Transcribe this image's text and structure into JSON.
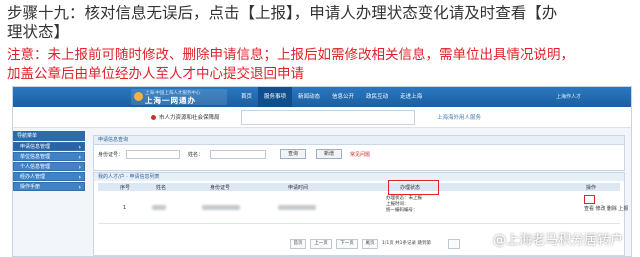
{
  "caption": {
    "line1": "步骤十九：核对信息无误后，点击【上报】，申请人办理状态变化请及时查看【办",
    "line2": "理状态】",
    "note1": "注意：未上报前可随时修改、删除申请信息；上报后如需修改相关信息，需单位出具情况说明，",
    "note2": "加盖公章后由单位经办人至人才中心提交退回申请"
  },
  "header": {
    "logo_top": "上海·中国上海人才服务中心",
    "logo_main": "上海一网通办",
    "nav": [
      "首页",
      "服务事项",
      "新闻动态",
      "信息公开",
      "政民互动",
      "走进上海"
    ],
    "active_nav": 1,
    "user": "上海作人才"
  },
  "subbar": {
    "dept": "市人力资源和社会保障局",
    "right_link": "上海海外用人服务"
  },
  "sidebar": {
    "head": "导航菜单",
    "items": [
      "申请信息管理",
      "单位信息管理",
      "个人信息管理",
      "经办人管理",
      "操作手册"
    ]
  },
  "search_panel": {
    "title": "申请信息查询",
    "id_label": "身份证号：",
    "name_label": "姓名：",
    "query_button": "查询",
    "add_button": "新增",
    "faq_link": "常见问题"
  },
  "list_panel": {
    "title": "我的人才/户 · 申请信息列表",
    "columns": [
      "序号",
      "姓名",
      "身份证号",
      "申请时间",
      "办理状态",
      "操作"
    ],
    "row": {
      "index": "1",
      "status_lines": [
        "办理状态：未上报",
        "上报时间：",
        "统一编码编号："
      ],
      "ops": [
        "查看",
        "修改",
        "删除",
        "上报"
      ]
    },
    "pager": {
      "first": "首页",
      "prev": "上一页",
      "next": "下一页",
      "last": "尾页",
      "info": "1/1页 共1条记录 跳到第"
    }
  },
  "watermark": "@上海老马积分居转户"
}
